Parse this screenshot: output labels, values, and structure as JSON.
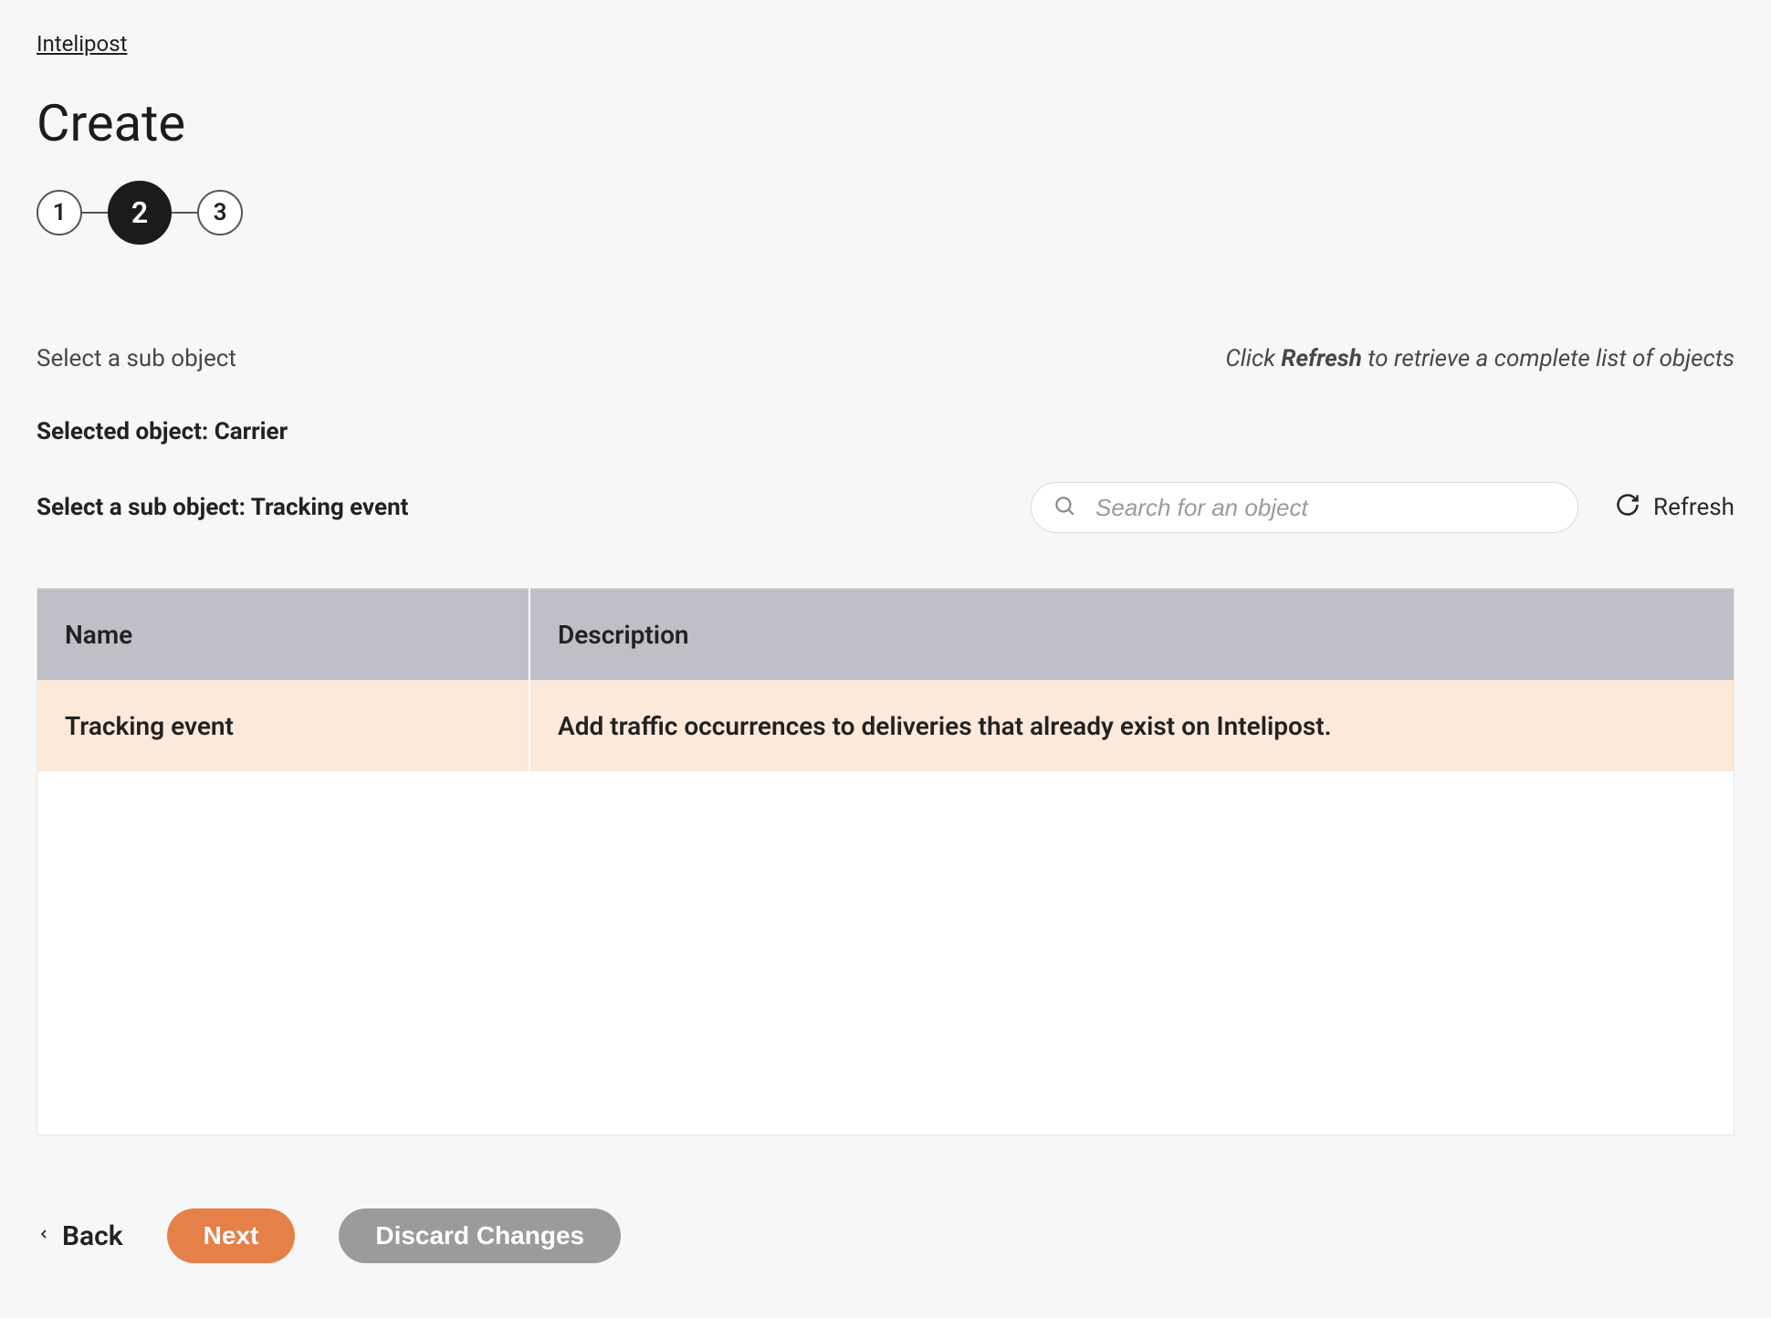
{
  "breadcrumb": "Intelipost",
  "title": "Create",
  "stepper": {
    "steps": [
      "1",
      "2",
      "3"
    ],
    "active_index": 1
  },
  "section": {
    "select_sub_object_label": "Select a sub object",
    "hint_prefix": "Click ",
    "hint_bold": "Refresh",
    "hint_suffix": " to retrieve a complete list of objects"
  },
  "selected_object_label": "Selected object: Carrier",
  "sub_object_label": "Select a sub object: Tracking event",
  "search": {
    "placeholder": "Search for an object"
  },
  "refresh_label": "Refresh",
  "table": {
    "headers": {
      "name": "Name",
      "description": "Description"
    },
    "rows": [
      {
        "name": "Tracking event",
        "description": "Add traffic occurrences to deliveries that already exist on Intelipost."
      }
    ]
  },
  "footer": {
    "back": "Back",
    "next": "Next",
    "discard": "Discard Changes"
  }
}
